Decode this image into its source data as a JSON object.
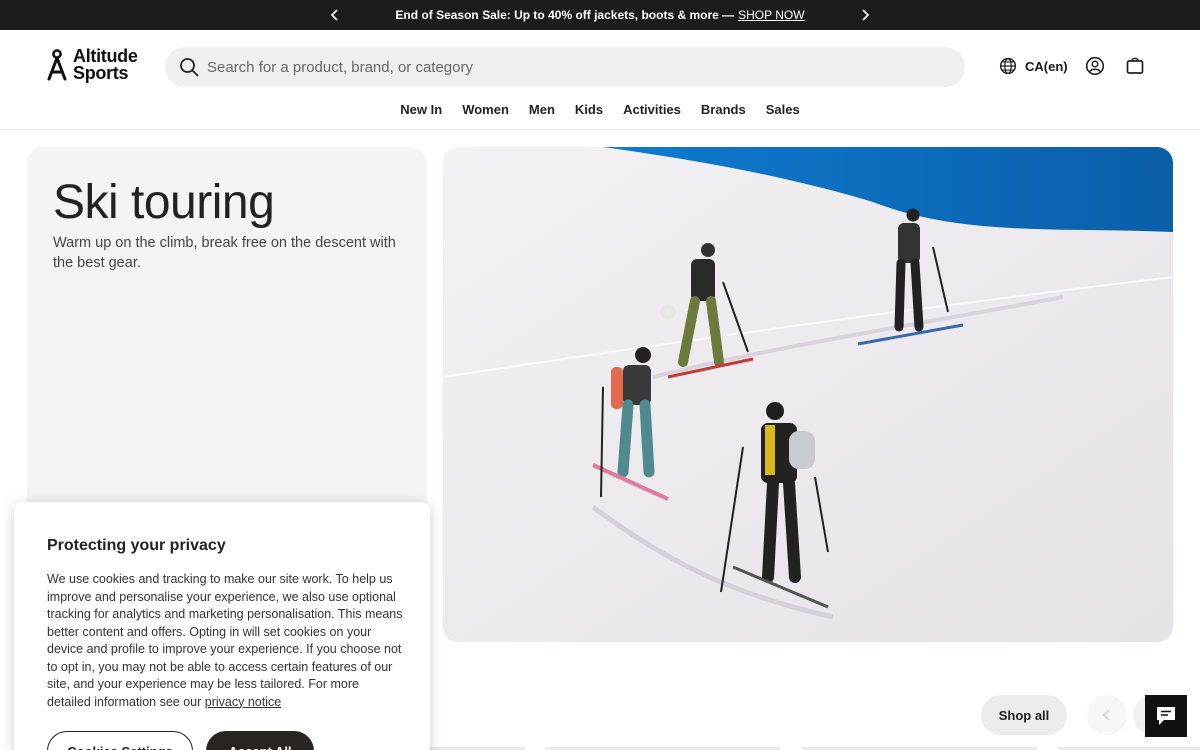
{
  "announcement": {
    "text": "End of Season Sale: Up to 40% off jackets, boots & more —",
    "cta": "SHOP NOW"
  },
  "brand": {
    "line1": "Altitude",
    "line2": "Sports"
  },
  "search": {
    "placeholder": "Search for a product, brand, or category"
  },
  "locale": {
    "label": "CA(en)"
  },
  "nav": {
    "items": [
      "New In",
      "Women",
      "Men",
      "Kids",
      "Activities",
      "Brands",
      "Sales"
    ]
  },
  "hero": {
    "title": "Ski touring",
    "subtitle": "Warm up on the climb, break free on the descent with the best gear."
  },
  "carousel": {
    "shop_all": "Shop all"
  },
  "cookie": {
    "title": "Protecting your privacy",
    "body": "We use cookies and tracking to make our site work. To help us improve and personalise your experience, we also use optional tracking for analytics and marketing personalisation. This means better content and offers. Opting in will set cookies on your device and profile to improve your experience. If you choose not to opt in, you may not be able to access certain features of our site, and your experience may be less tailored. For more detailed information see our",
    "link": "privacy notice",
    "settings_button": "Cookies Settings",
    "accept_button": "Accept All"
  },
  "colors": {
    "announcement_bg": "#1c1c1c",
    "search_bg": "#efefef",
    "hero_card_bg": "#f4f4f4",
    "sky": "#1565b0",
    "accept_bg": "#2a2420"
  },
  "icons": {
    "announce_prev": "chevron-left-icon",
    "announce_next": "chevron-right-icon",
    "search": "search-icon",
    "locale": "globe-icon",
    "account": "user-icon",
    "bag": "shopping-bag-icon",
    "chat": "chat-icon"
  }
}
